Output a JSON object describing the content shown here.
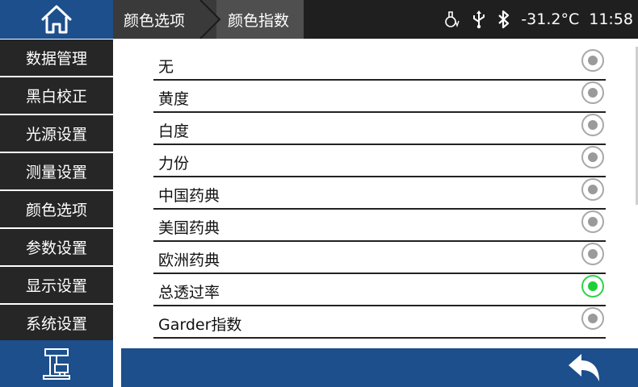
{
  "header": {
    "home_icon": "home-icon",
    "breadcrumb": [
      "颜色选项",
      "颜色指数"
    ],
    "status": {
      "temperature": "-31.2°C",
      "time": "11:58",
      "icons": [
        "lamp-icon",
        "usb-icon",
        "bluetooth-icon"
      ]
    }
  },
  "sidebar": {
    "items": [
      "数据管理",
      "黑白校正",
      "光源设置",
      "测量设置",
      "颜色选项",
      "参数设置",
      "显示设置",
      "系统设置"
    ],
    "footer_icon": "instrument-icon"
  },
  "options": [
    {
      "label": "无",
      "selected": false
    },
    {
      "label": "黄度",
      "selected": false
    },
    {
      "label": "白度",
      "selected": false
    },
    {
      "label": "力份",
      "selected": false
    },
    {
      "label": "中国药典",
      "selected": false
    },
    {
      "label": "美国药典",
      "selected": false
    },
    {
      "label": "欧洲药典",
      "selected": false
    },
    {
      "label": "总透过率",
      "selected": true
    },
    {
      "label": "Garder指数",
      "selected": false
    }
  ],
  "footer": {
    "back_icon": "back-arrow-icon"
  },
  "colors": {
    "accent": "#1c4f8c",
    "selected": "#1fcf3a",
    "sidebar": "#262626"
  }
}
